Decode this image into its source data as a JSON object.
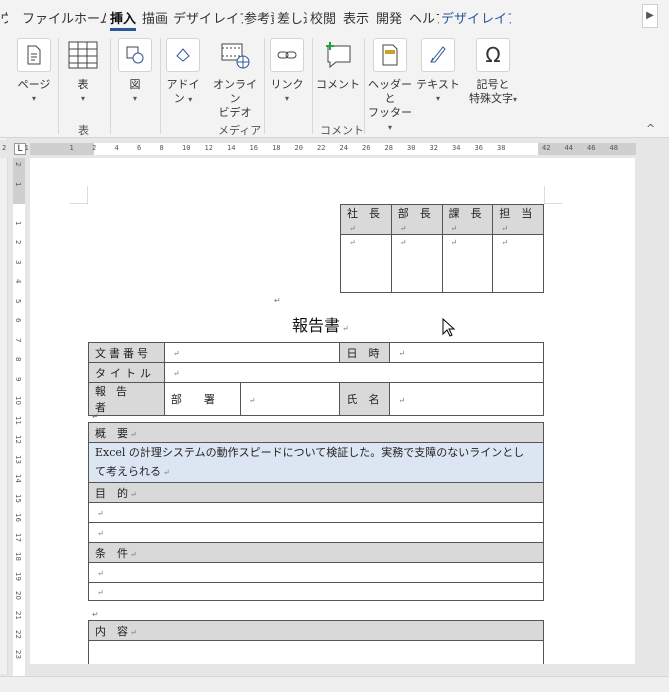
{
  "tabs": {
    "items": [
      {
        "label": "ウ"
      },
      {
        "label": "ファイル"
      },
      {
        "label": "ホーム"
      },
      {
        "label": "挿入"
      },
      {
        "label": "描画"
      },
      {
        "label": "デザイン"
      },
      {
        "label": "レイアウト"
      },
      {
        "label": "参考資料"
      },
      {
        "label": "差し込み文書"
      },
      {
        "label": "校閲"
      },
      {
        "label": "表示"
      },
      {
        "label": "開発"
      },
      {
        "label": "ヘルプ"
      },
      {
        "label": "デザイン"
      },
      {
        "label": "レイアウト"
      }
    ],
    "scroll_glyph": "▶"
  },
  "ribbon": {
    "page_label": "ページ",
    "table_label": "表",
    "picture_label": "図",
    "addin_label_1": "アドイ",
    "addin_label_2": "ン",
    "online_video_label_1": "オンライン",
    "online_video_label_2": "ビデオ",
    "link_label": "リンク",
    "comment_label": "コメント",
    "header_footer_label_1": "ヘッダーと",
    "header_footer_label_2": "フッター",
    "textbox_label": "テキスト",
    "symbol_label_1": "記号と",
    "symbol_label_2": "特殊文字",
    "groups": {
      "table": "表",
      "media": "メディア",
      "comment": "コメント"
    },
    "collapse_glyph": "^",
    "caret": "▾"
  },
  "ruler": {
    "tab_glyph": "L",
    "h_numbers": [
      "2",
      "1",
      "",
      "1",
      "2",
      "4",
      "6",
      "8",
      "10",
      "12",
      "14",
      "16",
      "18",
      "20",
      "22",
      "24",
      "26",
      "28",
      "30",
      "32",
      "34",
      "36",
      "38",
      "",
      "42",
      "44",
      "46",
      "48"
    ],
    "v_numbers": [
      "2",
      "1",
      "",
      "1",
      "2",
      "3",
      "4",
      "5",
      "6",
      "7",
      "8",
      "9",
      "10",
      "11",
      "12",
      "13",
      "14",
      "15",
      "16",
      "17",
      "18",
      "19",
      "20",
      "21",
      "22",
      "23"
    ]
  },
  "document": {
    "approval": {
      "headers": [
        "社　長",
        "部　長",
        "課　長",
        "担　当"
      ],
      "return_mark": "↵"
    },
    "title": "報告書",
    "info": {
      "doc_number_label": "文書番号",
      "date_label": "日　時",
      "subject_label": "タイトル",
      "reporter_label": "報告者",
      "dept_label": "部　　署",
      "name_label": "氏　名"
    },
    "summary": {
      "label": "概　要",
      "text_1": "Excel の計理システムの動作スピードについて検証した。実務で支障のないラインとし",
      "text_2": "て考えられる"
    },
    "purpose": {
      "label": "目　的"
    },
    "conditions": {
      "label": "条　件"
    },
    "content": {
      "label": "内　容"
    }
  }
}
